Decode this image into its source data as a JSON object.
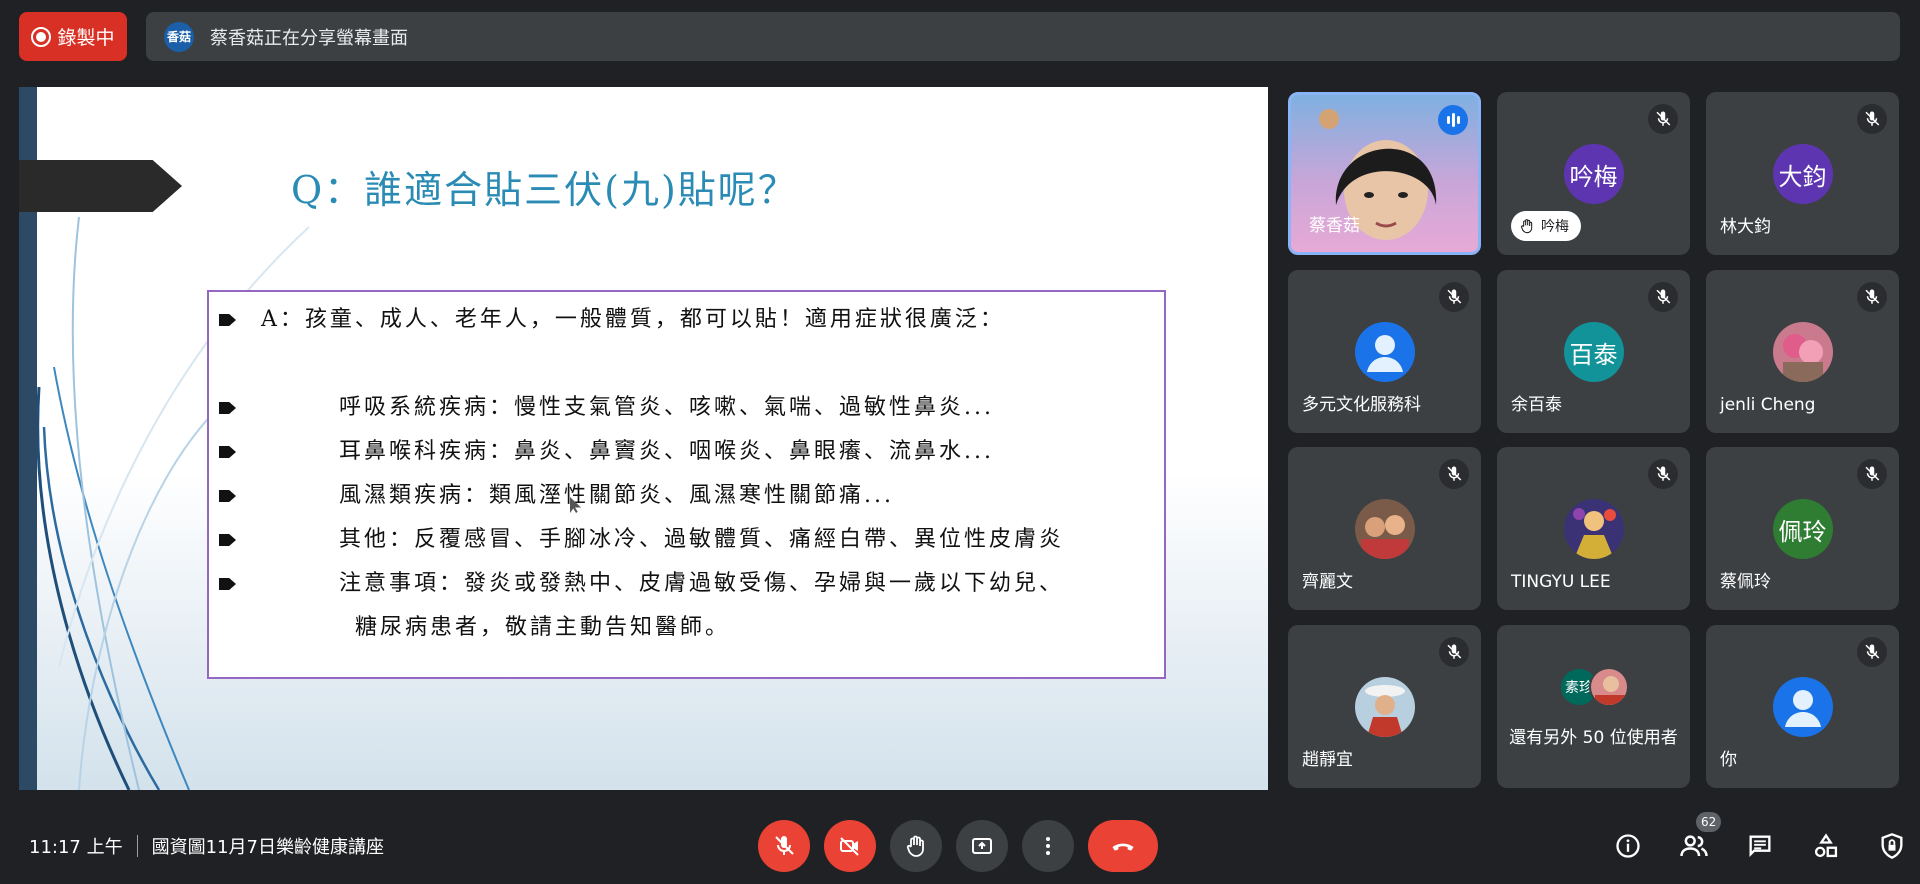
{
  "recording": {
    "label": "錄製中"
  },
  "share_bar": {
    "avatar_text": "香菇",
    "message": "蔡香菇正在分享螢幕畫面"
  },
  "slide": {
    "title": "Q：誰適合貼三伏(九)貼呢？",
    "lines": [
      "A：孩童、成人、老年人，一般體質，都可以貼！適用症狀很廣泛：",
      "呼吸系統疾病：慢性支氣管炎、咳嗽、氣喘、過敏性鼻炎...",
      "耳鼻喉科疾病：鼻炎、鼻竇炎、咽喉炎、鼻眼癢、流鼻水...",
      "風濕類疾病：類風溼性關節炎、風濕寒性關節痛...",
      "其他：反覆感冒、手腳冰冷、過敏體質、痛經白帶、異位性皮膚炎",
      "注意事項：發炎或發熱中、皮膚過敏受傷、孕婦與一歲以下幼兒、",
      "糖尿病患者，敬請主動告知醫師。"
    ]
  },
  "participants": [
    {
      "name": "蔡香菇",
      "speaking": true
    },
    {
      "name": "吟梅",
      "initials": "吟梅",
      "avatar_color": "#5e35b1",
      "hand_raised": true,
      "hand_label": "吟梅"
    },
    {
      "name": "林大鈞",
      "initials": "大鈞",
      "avatar_color": "#5e35b1"
    },
    {
      "name": "多元文化服務科",
      "avatar_color": "#1a73e8",
      "avatar_icon": "person-icon"
    },
    {
      "name": "余百泰",
      "initials": "百泰",
      "avatar_color": "#12939a"
    },
    {
      "name": "jenli Cheng",
      "avatar_photo": true
    },
    {
      "name": "齊麗文",
      "avatar_photo": true
    },
    {
      "name": "TINGYU LEE",
      "avatar_photo": true
    },
    {
      "name": "蔡佩玲",
      "initials": "佩玲",
      "avatar_color": "#2e7d32"
    },
    {
      "name": "趙靜宜",
      "avatar_photo": true
    },
    {
      "name": "還有另外 50 位使用者",
      "initials": "素珍",
      "avatar_color": "#00695c"
    },
    {
      "name": "你",
      "avatar_color": "#1a73e8",
      "avatar_icon": "person-icon"
    }
  ],
  "bottom": {
    "time": "11:17 上午",
    "meeting_title": "國資圖11月7日樂齡健康講座",
    "participant_count": "62"
  },
  "colors": {
    "accent": "#8ab4f8",
    "danger": "#ea4335",
    "bg": "#202124",
    "tile": "#3c4043"
  }
}
